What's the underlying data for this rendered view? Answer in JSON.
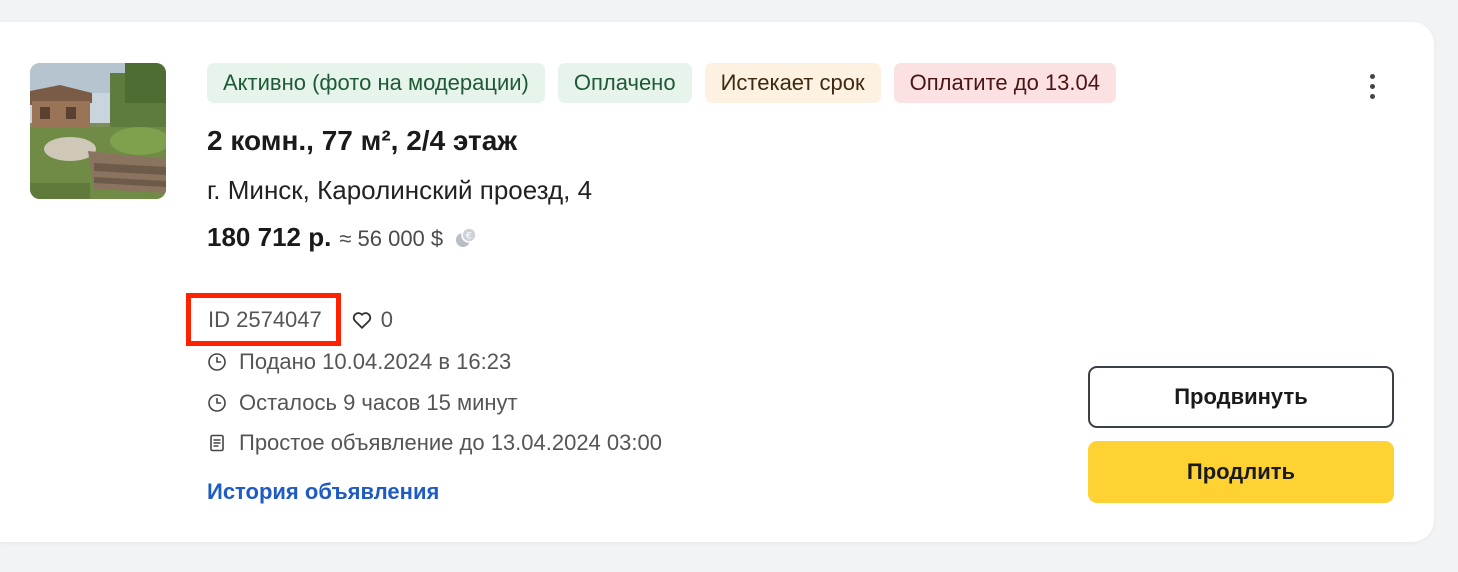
{
  "listing": {
    "badges": [
      {
        "label": "Активно (фото на модерации)",
        "tone": "green"
      },
      {
        "label": "Оплачено",
        "tone": "green"
      },
      {
        "label": "Истекает срок",
        "tone": "orange"
      },
      {
        "label": "Оплатите до 13.04",
        "tone": "red"
      }
    ],
    "title": "2 комн., 77 м², 2/4 этаж",
    "address": "г. Минск, Каролинский проезд, 4",
    "price": "180 712 р.",
    "price_approx": "≈ 56 000 $",
    "id_label": "ID 2574047",
    "favorites_count": "0",
    "submitted": "Подано 10.04.2024 в 16:23",
    "remaining": "Осталось 9 часов 15 минут",
    "plan": "Простое объявление до 13.04.2024 03:00",
    "history_link": "История объявления"
  },
  "actions": {
    "promote_label": "Продвинуть",
    "extend_label": "Продлить"
  },
  "colors": {
    "highlight_box": "#ff2200",
    "extend_button": "#fdd232",
    "link": "#1f5bc4",
    "badge_green_bg": "#e7f4ec",
    "badge_orange_bg": "#fdf1e2",
    "badge_red_bg": "#fbe1e1"
  },
  "icons": [
    "more-vertical-icon",
    "currency-exchange-icon",
    "heart-icon",
    "clock-icon",
    "document-icon"
  ]
}
